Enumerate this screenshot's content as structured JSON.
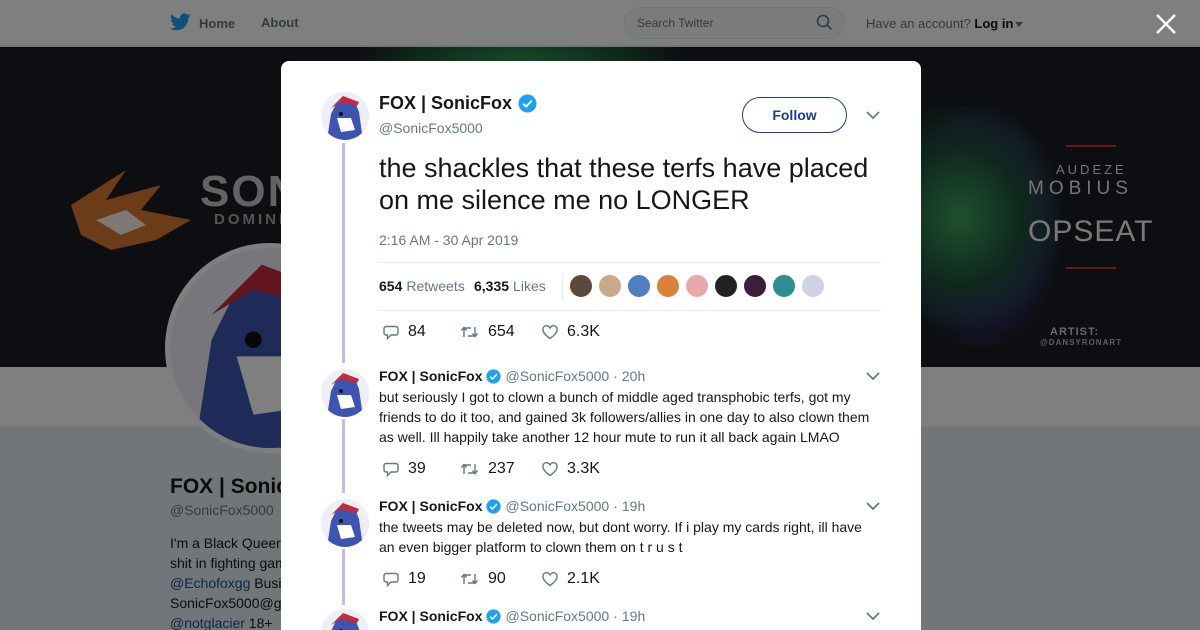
{
  "nav": {
    "home_label": "Home",
    "about_label": "About",
    "search_placeholder": "Search Twitter",
    "account_prompt": "Have an account?",
    "login_label": "Log in"
  },
  "banner": {
    "brand_text": "SONIC",
    "brand_sub": "DOMINIC",
    "sponsor_1": "AUDEZE",
    "sponsor_2": "MOBIUS",
    "sponsor_3": "OPSEAT",
    "artist_label": "ARTIST:",
    "artist_name": "@DANSYRONART"
  },
  "profile": {
    "name": "FOX | Sonic",
    "handle": "@SonicFox5000",
    "bio_line1": "I'm a Black Queer",
    "bio_line2": "shit in fighting gam",
    "bio_link1": "@Echofoxgg",
    "bio_line3_rest": " Busi",
    "bio_line4": "SonicFox5000@g",
    "bio_link2": "@notglacier",
    "bio_line5_rest": " 18+"
  },
  "tweet": {
    "name": "FOX | SonicFox",
    "handle": "@SonicFox5000",
    "follow_label": "Follow",
    "text": "the shackles that these terfs have placed on me silence me no LONGER",
    "time": "2:16 AM - 30 Apr 2019",
    "retweets_count": "654",
    "retweets_label": "Retweets",
    "likes_count": "6,335",
    "likes_label": "Likes",
    "actions": {
      "replies": "84",
      "retweets": "654",
      "likes": "6.3K"
    },
    "liker_colors": [
      "#5b4a3a",
      "#caa98a",
      "#4f7fbf",
      "#d9823a",
      "#e6a8a8",
      "#222222",
      "#3a1f3a",
      "#2f8f8f",
      "#cfd3e8"
    ]
  },
  "replies": [
    {
      "name": "FOX | SonicFox",
      "handle": "@SonicFox5000",
      "time": "20h",
      "text": "but seriously I got to clown a bunch of middle aged transphobic terfs, got my friends to do it too, and gained 3k followers/allies in one day to also clown them as well. Ill happily take another 12 hour mute to run it all back again LMAO",
      "replies": "39",
      "retweets": "237",
      "likes": "3.3K"
    },
    {
      "name": "FOX | SonicFox",
      "handle": "@SonicFox5000",
      "time": "19h",
      "text": "the tweets may be deleted now, but dont worry. If i play my cards right, ill have an even bigger platform to clown them on t r u s t",
      "replies": "19",
      "retweets": "90",
      "likes": "2.1K"
    },
    {
      "name": "FOX | SonicFox",
      "handle": "@SonicFox5000",
      "time": "19h"
    }
  ],
  "colors": {
    "twitter_blue": "#1da1f2",
    "link_blue": "#1b4f8c",
    "thread_line": "#c2bde6",
    "follow_border": "#1b3f8c"
  }
}
